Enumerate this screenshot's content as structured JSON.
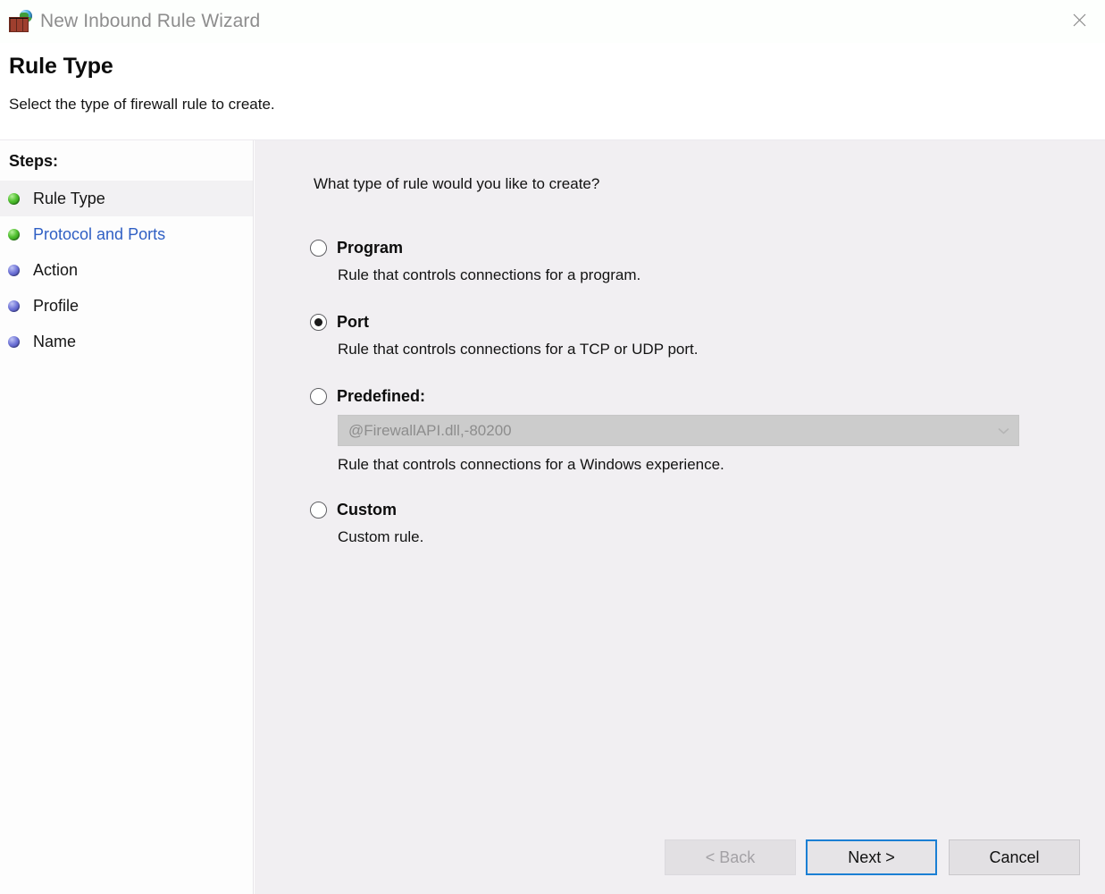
{
  "window": {
    "title": "New Inbound Rule Wizard",
    "icon": "firewall-brick-globe-icon",
    "close_label": "✕"
  },
  "header": {
    "title": "Rule Type",
    "subtitle": "Select the type of firewall rule to create."
  },
  "sidebar": {
    "heading": "Steps:",
    "items": [
      {
        "label": "Rule Type",
        "bullet": "green",
        "state": "active"
      },
      {
        "label": "Protocol and Ports",
        "bullet": "green",
        "state": "link"
      },
      {
        "label": "Action",
        "bullet": "blue",
        "state": "pending"
      },
      {
        "label": "Profile",
        "bullet": "blue",
        "state": "pending"
      },
      {
        "label": "Name",
        "bullet": "blue",
        "state": "pending"
      }
    ]
  },
  "main": {
    "question": "What type of rule would you like to create?",
    "options": [
      {
        "title": "Program",
        "description": "Rule that controls connections for a program.",
        "selected": false
      },
      {
        "title": "Port",
        "description": "Rule that controls connections for a TCP or UDP port.",
        "selected": true
      },
      {
        "title": "Predefined:",
        "description": "Rule that controls connections for a Windows experience.",
        "selected": false,
        "combo_value": "@FirewallAPI.dll,-80200",
        "combo_disabled": true
      },
      {
        "title": "Custom",
        "description": "Custom rule.",
        "selected": false
      }
    ]
  },
  "footer": {
    "back_label": "< Back",
    "next_label": "Next >",
    "cancel_label": "Cancel",
    "back_disabled": true,
    "next_is_default": true
  },
  "colors": {
    "accent_blue": "#1b7fd4",
    "link_blue": "#2f5fc4",
    "content_bg": "#f1eff2",
    "step_done": "#4fbf2e",
    "step_pending": "#6d72d6"
  }
}
